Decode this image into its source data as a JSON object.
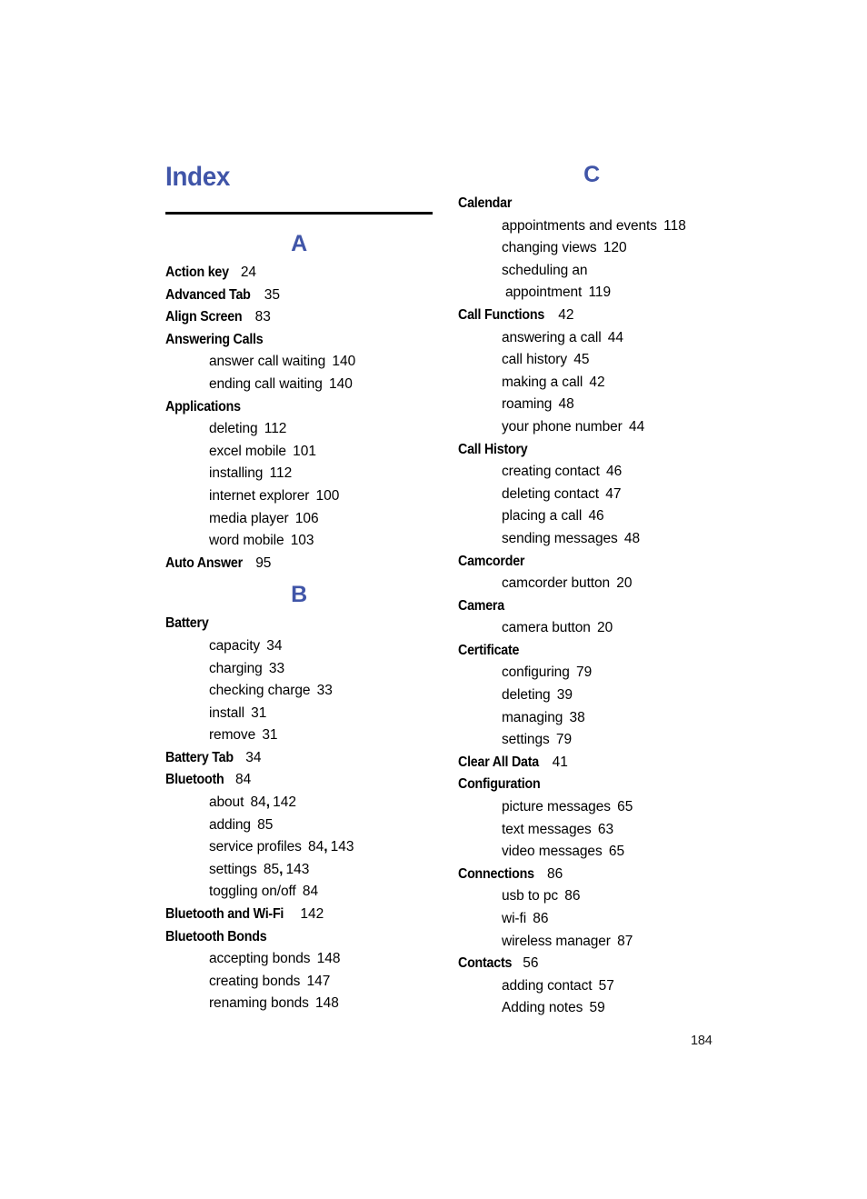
{
  "document": {
    "title": "Index",
    "page_number": "184",
    "accent_color": "#4055A8",
    "text_color": "#000000"
  },
  "columns": [
    {
      "name": "left-column",
      "sections": [
        {
          "letter": "A",
          "entries": [
            {
              "type": "main",
              "term": "Action key",
              "pages": "24"
            },
            {
              "type": "main",
              "term": "Advanced Tab",
              "pages": "35"
            },
            {
              "type": "main",
              "term": "Align Screen",
              "pages": "83"
            },
            {
              "type": "main",
              "term": "Answering Calls",
              "pages": ""
            },
            {
              "type": "sub",
              "term": "answer call waiting",
              "pages": "140"
            },
            {
              "type": "sub",
              "term": "ending call waiting",
              "pages": "140"
            },
            {
              "type": "main",
              "term": "Applications",
              "pages": ""
            },
            {
              "type": "sub",
              "term": "deleting",
              "pages": "112"
            },
            {
              "type": "sub",
              "term": "excel mobile",
              "pages": "101"
            },
            {
              "type": "sub",
              "term": "installing",
              "pages": "112"
            },
            {
              "type": "sub",
              "term": "internet explorer",
              "pages": "100"
            },
            {
              "type": "sub",
              "term": "media player",
              "pages": "106"
            },
            {
              "type": "sub",
              "term": "word mobile",
              "pages": "103"
            },
            {
              "type": "main",
              "term": "Auto Answer",
              "pages": "95"
            }
          ]
        },
        {
          "letter": "B",
          "entries": [
            {
              "type": "main",
              "term": "Battery",
              "pages": ""
            },
            {
              "type": "sub",
              "term": "capacity",
              "pages": "34"
            },
            {
              "type": "sub",
              "term": "charging",
              "pages": "33"
            },
            {
              "type": "sub",
              "term": "checking charge",
              "pages": "33"
            },
            {
              "type": "sub",
              "term": "install",
              "pages": "31"
            },
            {
              "type": "sub",
              "term": "remove",
              "pages": "31"
            },
            {
              "type": "main",
              "term": "Battery Tab",
              "pages": "34"
            },
            {
              "type": "main",
              "term": "Bluetooth",
              "pages": "84"
            },
            {
              "type": "sub",
              "term": "about",
              "pages": "84, 142"
            },
            {
              "type": "sub",
              "term": "adding",
              "pages": "85"
            },
            {
              "type": "sub",
              "term": "service profiles",
              "pages": "84, 143"
            },
            {
              "type": "sub",
              "term": "settings",
              "pages": "85, 143"
            },
            {
              "type": "sub",
              "term": "toggling on/off",
              "pages": "84"
            },
            {
              "type": "main",
              "term": "Bluetooth and Wi-Fi",
              "pages": "142"
            },
            {
              "type": "main",
              "term": "Bluetooth Bonds",
              "pages": ""
            },
            {
              "type": "sub",
              "term": "accepting bonds",
              "pages": "148"
            },
            {
              "type": "sub",
              "term": "creating bonds",
              "pages": "147"
            },
            {
              "type": "sub",
              "term": "renaming bonds",
              "pages": "148"
            }
          ]
        }
      ]
    },
    {
      "name": "right-column",
      "sections": [
        {
          "letter": "C",
          "entries": [
            {
              "type": "main",
              "term": "Calendar",
              "pages": ""
            },
            {
              "type": "sub",
              "term": "appointments and events",
              "pages": "118"
            },
            {
              "type": "sub",
              "term": "changing views",
              "pages": "120"
            },
            {
              "type": "sub",
              "term": "scheduling an",
              "pages": ""
            },
            {
              "type": "sub-cont",
              "term": "appointment",
              "pages": "119"
            },
            {
              "type": "main",
              "term": "Call Functions",
              "pages": "42"
            },
            {
              "type": "sub",
              "term": "answering a call",
              "pages": "44"
            },
            {
              "type": "sub",
              "term": "call history",
              "pages": "45"
            },
            {
              "type": "sub",
              "term": "making a call",
              "pages": "42"
            },
            {
              "type": "sub",
              "term": "roaming",
              "pages": "48"
            },
            {
              "type": "sub",
              "term": "your phone number",
              "pages": "44"
            },
            {
              "type": "main",
              "term": "Call History",
              "pages": ""
            },
            {
              "type": "sub",
              "term": "creating contact",
              "pages": "46"
            },
            {
              "type": "sub",
              "term": "deleting contact",
              "pages": "47"
            },
            {
              "type": "sub",
              "term": "placing a call",
              "pages": "46"
            },
            {
              "type": "sub",
              "term": "sending messages",
              "pages": "48"
            },
            {
              "type": "main",
              "term": "Camcorder",
              "pages": ""
            },
            {
              "type": "sub",
              "term": "camcorder button",
              "pages": "20"
            },
            {
              "type": "main",
              "term": "Camera",
              "pages": ""
            },
            {
              "type": "sub",
              "term": "camera button",
              "pages": "20"
            },
            {
              "type": "main",
              "term": "Certificate",
              "pages": ""
            },
            {
              "type": "sub",
              "term": "configuring",
              "pages": "79"
            },
            {
              "type": "sub",
              "term": "deleting",
              "pages": "39"
            },
            {
              "type": "sub",
              "term": "managing",
              "pages": "38"
            },
            {
              "type": "sub",
              "term": "settings",
              "pages": "79"
            },
            {
              "type": "main",
              "term": "Clear All Data",
              "pages": "41"
            },
            {
              "type": "main",
              "term": "Configuration",
              "pages": ""
            },
            {
              "type": "sub",
              "term": "picture messages",
              "pages": "65"
            },
            {
              "type": "sub",
              "term": "text messages",
              "pages": "63"
            },
            {
              "type": "sub",
              "term": "video messages",
              "pages": "65"
            },
            {
              "type": "main",
              "term": "Connections",
              "pages": "86"
            },
            {
              "type": "sub",
              "term": "usb to pc",
              "pages": "86"
            },
            {
              "type": "sub",
              "term": "wi-fi",
              "pages": "86"
            },
            {
              "type": "sub",
              "term": "wireless manager",
              "pages": "87"
            },
            {
              "type": "main",
              "term": "Contacts",
              "pages": "56"
            },
            {
              "type": "sub",
              "term": "adding contact",
              "pages": "57"
            },
            {
              "type": "sub",
              "term": "Adding notes",
              "pages": "59"
            }
          ]
        }
      ]
    }
  ]
}
